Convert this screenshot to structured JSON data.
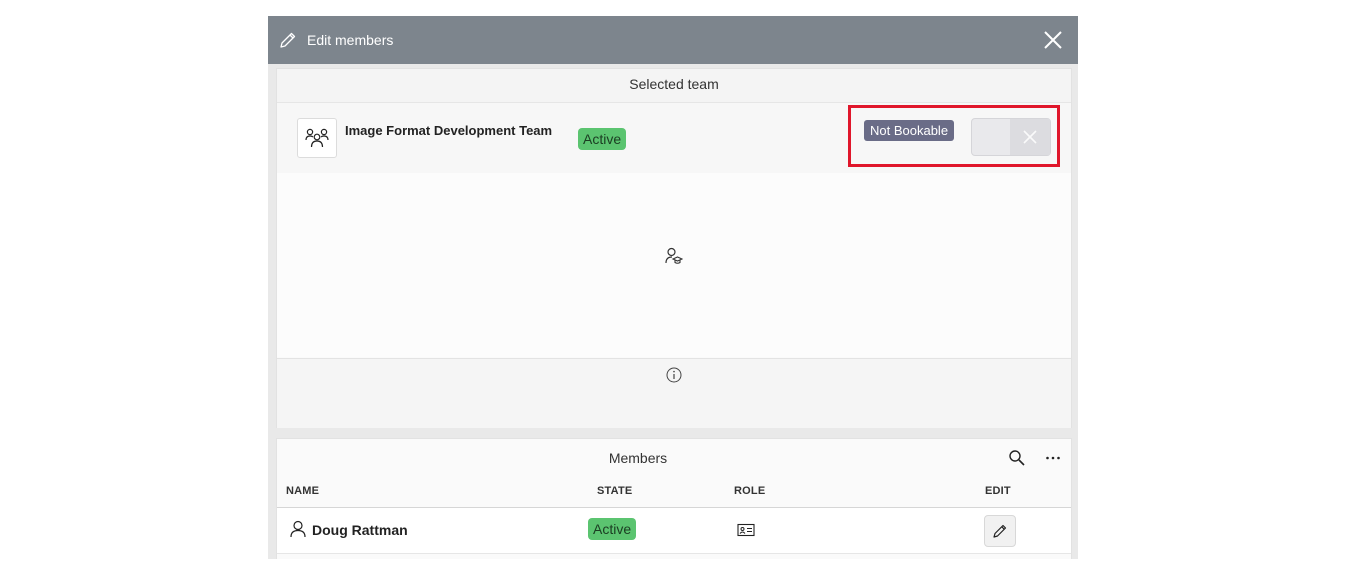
{
  "dialog": {
    "title": "Edit members",
    "title_icon": "pencil-icon",
    "close_icon": "close-icon"
  },
  "team_section": {
    "header": "Selected team",
    "team_name": "Image Format Development Team",
    "team_icon": "team-icon",
    "status": "Active",
    "bookable_label": "Not Bookable",
    "bookable_toggle": false,
    "empty_state_icon": "user-education-icon",
    "info_icon": "info-icon"
  },
  "members": {
    "title": "Members",
    "columns": [
      "NAME",
      "STATE",
      "ROLE",
      "EDIT"
    ],
    "rows": [
      {
        "name": "Doug Rattman",
        "state": "Active",
        "role_icon": "id-card-icon",
        "edit_icon": "pencil-icon"
      }
    ]
  },
  "colors": {
    "titlebar": "#7d858d",
    "active_badge": "#5bc470",
    "not_bookable_badge": "#6a6c87",
    "highlight": "#e0162b"
  }
}
